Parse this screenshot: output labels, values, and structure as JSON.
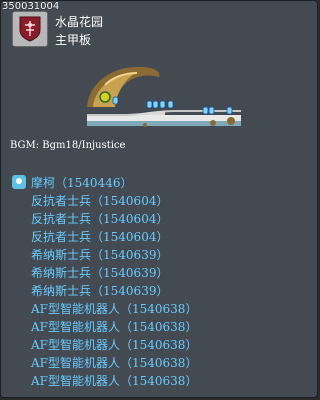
{
  "map": {
    "id": "350031004",
    "name": "水晶花园",
    "street": "主甲板",
    "bgm": "BGM: Bgm18/Injustice"
  },
  "icons": {
    "map_icon": "guild-shield-icon",
    "npc_icon": "npc-icon"
  },
  "colors": {
    "panel": "#434a52",
    "list_text": "#66ccff"
  },
  "npcs": [
    {
      "name": "摩柯",
      "id": "（1540446）",
      "type": "npc"
    },
    {
      "name": "反抗者士兵",
      "id": "（1540604）",
      "type": "monster"
    },
    {
      "name": "反抗者士兵",
      "id": "（1540604）",
      "type": "monster"
    },
    {
      "name": "反抗者士兵",
      "id": "（1540604）",
      "type": "monster"
    },
    {
      "name": "希纳斯士兵",
      "id": "（1540639）",
      "type": "monster"
    },
    {
      "name": "希纳斯士兵",
      "id": "（1540639）",
      "type": "monster"
    },
    {
      "name": "希纳斯士兵",
      "id": "（1540639）",
      "type": "monster"
    },
    {
      "name": "AF型智能机器人",
      "id": "（1540638）",
      "type": "monster"
    },
    {
      "name": "AF型智能机器人",
      "id": "（1540638）",
      "type": "monster"
    },
    {
      "name": "AF型智能机器人",
      "id": "（1540638）",
      "type": "monster"
    },
    {
      "name": "AF型智能机器人",
      "id": "（1540638）",
      "type": "monster"
    },
    {
      "name": "AF型智能机器人",
      "id": "（1540638）",
      "type": "monster"
    }
  ]
}
